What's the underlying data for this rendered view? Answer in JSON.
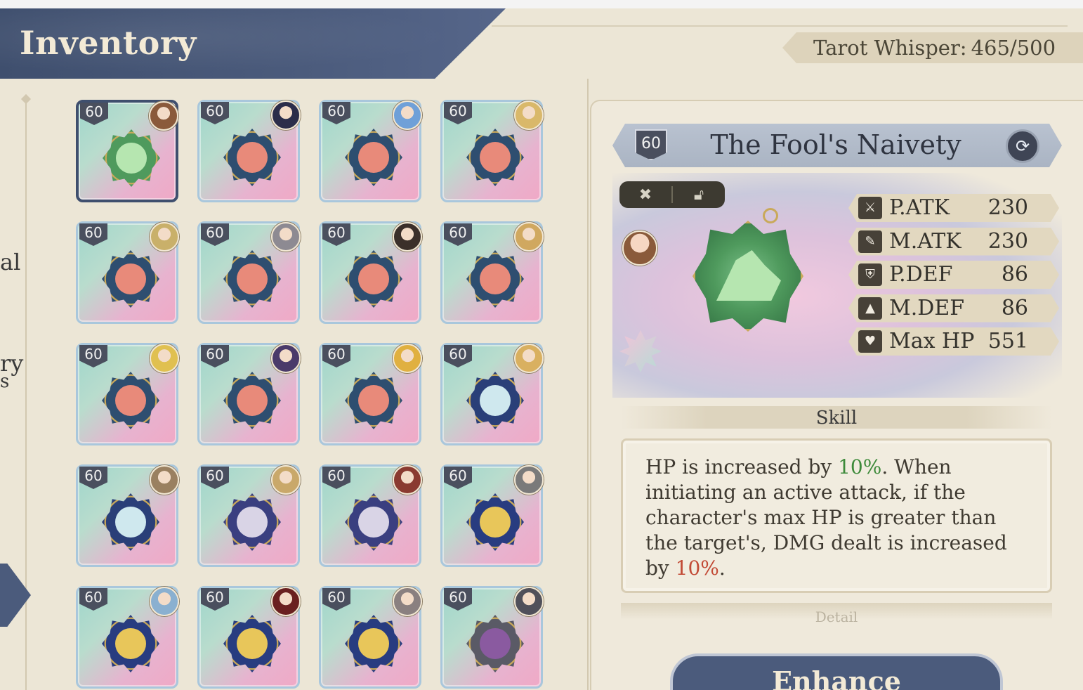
{
  "header": {
    "title": "Inventory",
    "currency_label": "Tarot Whisper:",
    "currency_value": "465/500"
  },
  "side_nav": {
    "labels": [
      "al",
      "ry",
      "s"
    ]
  },
  "inventory": {
    "items": [
      {
        "level": "60",
        "emblem": "green-jester-hat",
        "emblem_color": "#4f9a5d",
        "selected": true
      },
      {
        "level": "60",
        "emblem": "red-hair-maiden",
        "emblem_color": "#2e4e70"
      },
      {
        "level": "60",
        "emblem": "red-hair-maiden",
        "emblem_color": "#2e4e70"
      },
      {
        "level": "60",
        "emblem": "red-hair-maiden",
        "emblem_color": "#2e4e70"
      },
      {
        "level": "60",
        "emblem": "red-hair-maiden",
        "emblem_color": "#2e4e70"
      },
      {
        "level": "60",
        "emblem": "red-hair-maiden",
        "emblem_color": "#2e4e70"
      },
      {
        "level": "60",
        "emblem": "red-hair-maiden",
        "emblem_color": "#2e4e70"
      },
      {
        "level": "60",
        "emblem": "red-hair-maiden",
        "emblem_color": "#2e4e70"
      },
      {
        "level": "60",
        "emblem": "red-hair-maiden",
        "emblem_color": "#2e4e70"
      },
      {
        "level": "60",
        "emblem": "red-hair-maiden",
        "emblem_color": "#2e4e70"
      },
      {
        "level": "60",
        "emblem": "red-hair-maiden",
        "emblem_color": "#2e4e70"
      },
      {
        "level": "60",
        "emblem": "stacked-books",
        "emblem_color": "#2a3f78"
      },
      {
        "level": "60",
        "emblem": "stacked-books",
        "emblem_color": "#2a3f78"
      },
      {
        "level": "60",
        "emblem": "hooded-sage",
        "emblem_color": "#3a3f80"
      },
      {
        "level": "60",
        "emblem": "hooded-sage",
        "emblem_color": "#3a3f80"
      },
      {
        "level": "60",
        "emblem": "golden-scales",
        "emblem_color": "#283c80"
      },
      {
        "level": "60",
        "emblem": "golden-scales",
        "emblem_color": "#283c80"
      },
      {
        "level": "60",
        "emblem": "golden-scales",
        "emblem_color": "#283c80"
      },
      {
        "level": "60",
        "emblem": "golden-scales",
        "emblem_color": "#283c80"
      },
      {
        "level": "60",
        "emblem": "winged-demon",
        "emblem_color": "#5a5a66"
      }
    ]
  },
  "detail": {
    "level": "60",
    "name": "The Fool's Naivety",
    "stats": [
      {
        "icon": "sword-icon",
        "glyph": "⚔",
        "label": "P.ATK",
        "value": "230"
      },
      {
        "icon": "wand-icon",
        "glyph": "✎",
        "label": "M.ATK",
        "value": "230"
      },
      {
        "icon": "shield-icon",
        "glyph": "⛨",
        "label": "P.DEF",
        "value": "86"
      },
      {
        "icon": "hat-icon",
        "glyph": "▲",
        "label": "M.DEF",
        "value": "86"
      },
      {
        "icon": "heart-icon",
        "glyph": "♥",
        "label": "Max HP",
        "value": "551"
      }
    ],
    "skill_title": "Skill",
    "skill_text": {
      "part1": "HP is increased by ",
      "hl1": "10%",
      "part2": ". When initiating an active attack, if the character's max HP is greater than the target's, DMG dealt is increased by ",
      "hl2": "10%",
      "part3": "."
    },
    "detail_label": "Detail",
    "enhance_label": "Enhance"
  },
  "colors": {
    "header": "#3f4f6e",
    "positive": "#3d8a3a",
    "negative": "#c24a35"
  }
}
